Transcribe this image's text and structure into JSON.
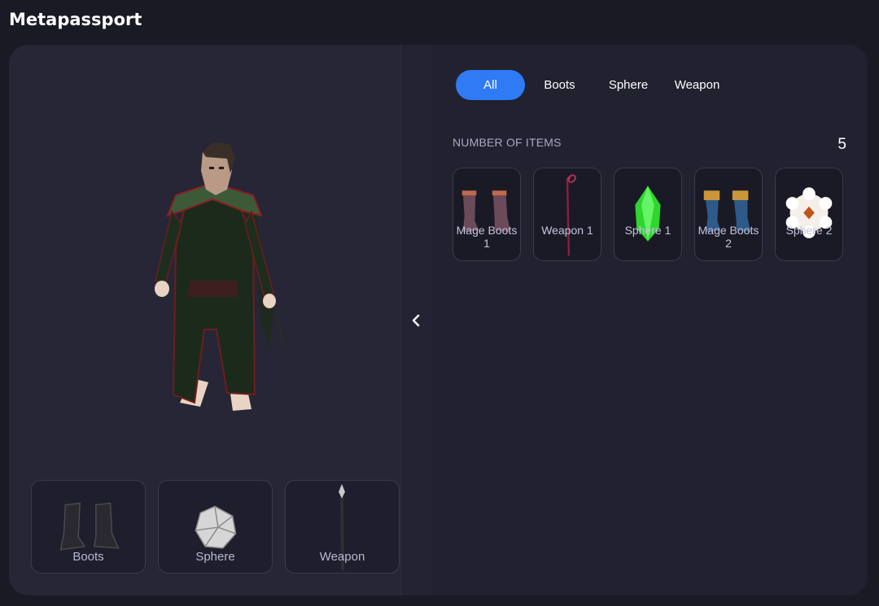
{
  "app": {
    "title": "Metapassport"
  },
  "equipped": [
    {
      "label": "Boots",
      "icon": "boots-icon"
    },
    {
      "label": "Sphere",
      "icon": "sphere-icon"
    },
    {
      "label": "Weapon",
      "icon": "weapon-icon"
    }
  ],
  "tabs": [
    {
      "label": "All",
      "active": true
    },
    {
      "label": "Boots",
      "active": false
    },
    {
      "label": "Sphere",
      "active": false
    },
    {
      "label": "Weapon",
      "active": false
    }
  ],
  "inventory": {
    "count_label": "NUMBER OF ITEMS",
    "count": "5",
    "items": [
      {
        "label": "Mage Boots 1",
        "icon": "mage-boots-icon"
      },
      {
        "label": "Weapon 1",
        "icon": "staff-icon"
      },
      {
        "label": "Sphere 1",
        "icon": "green-crystal-icon"
      },
      {
        "label": "Mage Boots 2",
        "icon": "mage-boots-icon"
      },
      {
        "label": "Sphere 2",
        "icon": "flower-sphere-icon"
      }
    ]
  },
  "colors": {
    "accent": "#2f7bf5",
    "panel": "#262636",
    "background": "#1a1a25"
  }
}
